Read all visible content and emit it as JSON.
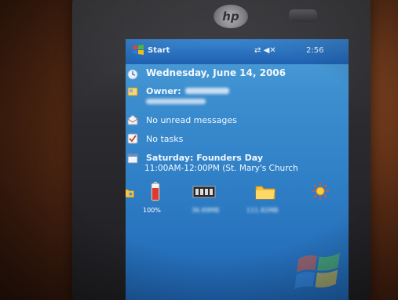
{
  "device": {
    "brand_logo": "hp"
  },
  "taskbar": {
    "start_label": "Start",
    "clock": "2:56",
    "icons": [
      "connectivity-icon",
      "volume-icon"
    ]
  },
  "today": {
    "date": "Wednesday, June 14, 2006",
    "owner_label": "Owner:",
    "messages": "No unread messages",
    "tasks": "No tasks",
    "appointment": {
      "title": "Saturday: Founders Day",
      "time": "11:00AM-12:00PM (St. Mary's Church"
    }
  },
  "status_icons": [
    {
      "name": "battery-icon",
      "label": "100%"
    },
    {
      "name": "memory-icon",
      "label": "36.89MB"
    },
    {
      "name": "storage-folder-icon",
      "label": "111.82MB"
    },
    {
      "name": "brightness-icon",
      "label": ""
    }
  ],
  "colors": {
    "screen_top": "#4fa0d8",
    "screen_bottom": "#2066b4",
    "taskbar": "#1e60b0"
  }
}
